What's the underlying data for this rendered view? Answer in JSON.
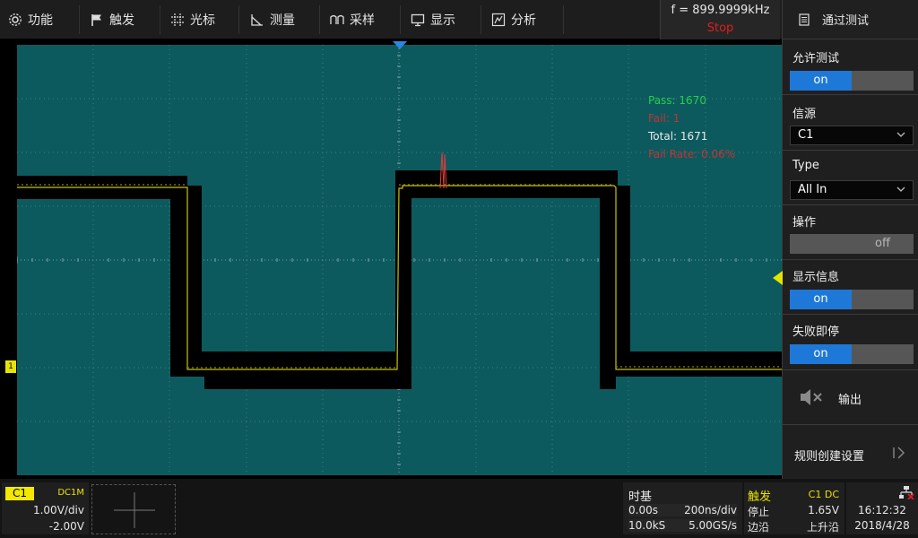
{
  "menu": {
    "items": [
      {
        "label": "功能",
        "icon": "gear-icon"
      },
      {
        "label": "触发",
        "icon": "flag-icon"
      },
      {
        "label": "光标",
        "icon": "cursor-icon"
      },
      {
        "label": "测量",
        "icon": "measure-icon"
      },
      {
        "label": "采样",
        "icon": "sampling-icon"
      },
      {
        "label": "显示",
        "icon": "display-icon"
      },
      {
        "label": "分析",
        "icon": "analysis-icon"
      }
    ]
  },
  "frequency": {
    "value": "f = 899.9999kHz",
    "status": "Stop"
  },
  "panel": {
    "title": "通过测试",
    "title_icon": "document-icon",
    "enable_test": {
      "label": "允许测试",
      "state": "on"
    },
    "source": {
      "label": "信源",
      "value": "C1"
    },
    "type": {
      "label": "Type",
      "value": "All In"
    },
    "operation": {
      "label": "操作",
      "state": "off"
    },
    "display_info": {
      "label": "显示信息",
      "state": "on"
    },
    "stop_on_fail": {
      "label": "失败即停",
      "state": "on"
    },
    "output": {
      "label": "输出",
      "icon": "speaker-mute-icon"
    },
    "rule_setup": {
      "label": "规则创建设置",
      "icon": "next-page-icon"
    }
  },
  "stats": {
    "pass": "Pass: 1670",
    "fail": "Fail: 1",
    "total": "Total: 1671",
    "fail_rate": "Fail Rate: 0.06%"
  },
  "channel1": {
    "tag": "C1",
    "coupling": "DC1M",
    "scale": "1.00V/div",
    "offset": "-2.00V",
    "marker": "1"
  },
  "timebase": {
    "title": "时基",
    "delay": "0.00s",
    "scale": "200ns/div",
    "memory": "10.0kS",
    "sample_rate": "5.00GS/s"
  },
  "trigger": {
    "title": "触发",
    "source": "C1 DC",
    "mode": "停止",
    "level": "1.65V",
    "type": "边沿",
    "slope": "上升沿"
  },
  "clock": {
    "time": "16:12:32",
    "date": "2018/4/28",
    "icon": "network-disconnected-icon"
  },
  "colors": {
    "grid_bg": "#0d5a5e",
    "trace": "#c8c400",
    "mask": "#000000",
    "accent_on": "#1e78d8",
    "stop_red": "#e21c1c",
    "pass_green": "#21d14a",
    "fail_red": "#c23333"
  }
}
